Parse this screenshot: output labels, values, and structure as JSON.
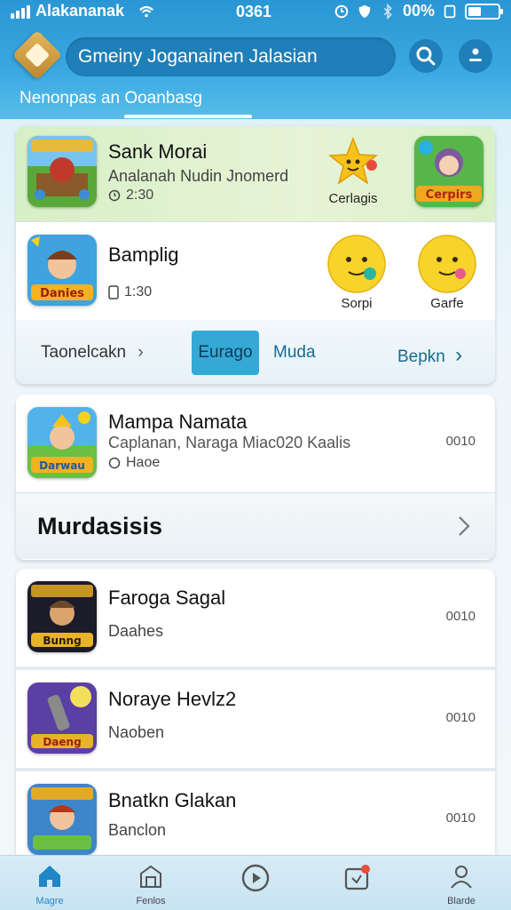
{
  "status": {
    "carrier": "Alakananak",
    "time": "0361",
    "battery_text": "00%"
  },
  "header": {
    "search_text": "Gmeiny Joganainen Jalasian",
    "sub_tab": "Nenonpas an Ooanbasg"
  },
  "featured": {
    "item1": {
      "title": "Sank Morai",
      "subtitle": "Analanah Nudin Jnomerd",
      "meta": "2:30",
      "badge_label": "Cerlagis",
      "tile_label": "Cerpirs"
    },
    "item2": {
      "title": "Bamplig",
      "meta": "1:30",
      "smiley1_label": "Sorpi",
      "smiley2_label": "Garfe"
    }
  },
  "tabs": {
    "left": "Taonelcakn",
    "active": "Eurago",
    "middle": "Muda",
    "right": "Bepkn"
  },
  "list1": {
    "title": "Mampa Namata",
    "subtitle": "Caplanan, Naraga Miac020 Kaalis",
    "meta": "Haoe",
    "value": "0010"
  },
  "section": {
    "title": "Murdasisis"
  },
  "list": [
    {
      "title": "Faroga Sagal",
      "subtitle": "Daahes",
      "value": "0010",
      "thumb_label": "Bunng"
    },
    {
      "title": "Noraye Hevlz2",
      "subtitle": "Naoben",
      "value": "0010",
      "thumb_label": "Daeng"
    },
    {
      "title": "Bnatkn Glakan",
      "subtitle": "Banclon",
      "value": "0010",
      "thumb_label": ""
    }
  ],
  "thumbs": {
    "t1_label": "Danies",
    "t2_label": "Darwau"
  },
  "nav": [
    {
      "label": "Magre"
    },
    {
      "label": "Fenlos"
    },
    {
      "label": ""
    },
    {
      "label": ""
    },
    {
      "label": "Blarde"
    }
  ],
  "colors": {
    "header": "#2a96d3",
    "accent": "#35a9d6",
    "active_nav": "#1f86c7"
  }
}
